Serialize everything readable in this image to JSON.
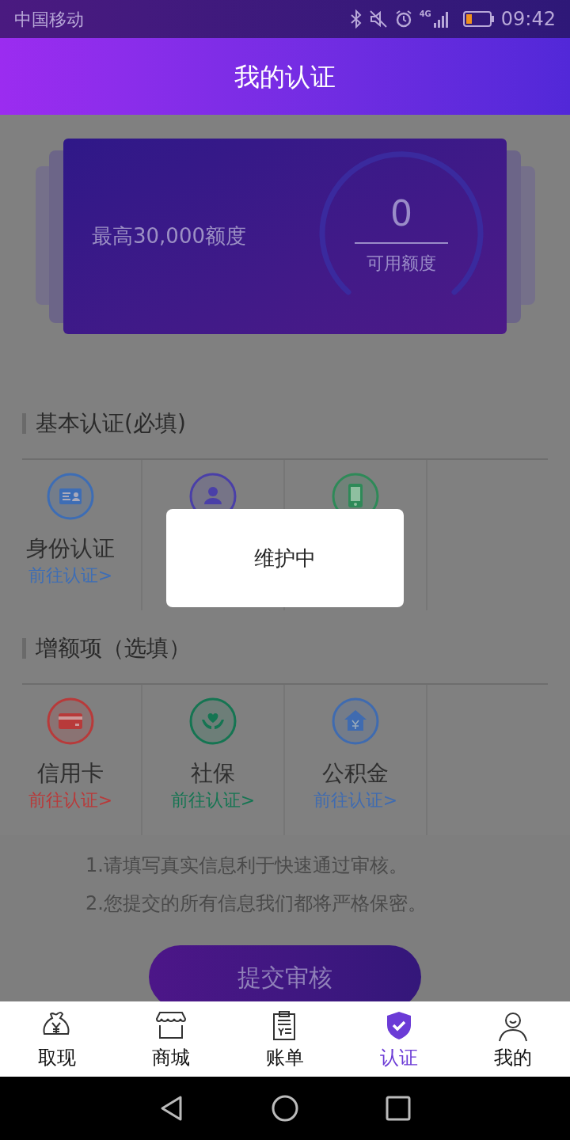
{
  "status_bar": {
    "carrier": "中国移动",
    "network": "4G",
    "time": "09:42"
  },
  "header": {
    "title": "我的认证"
  },
  "quota_card": {
    "headline": "最高30,000额度",
    "amount": "0",
    "amount_label": "可用额度"
  },
  "basic_section": {
    "title": "基本认证(必填)",
    "items": [
      {
        "kind": "id-card",
        "label": "身份认证",
        "link": "前往认证>",
        "color": "#3d6db5"
      },
      {
        "kind": "person",
        "color": "#4a3fa8"
      },
      {
        "kind": "phone",
        "color": "#2e8a58"
      }
    ]
  },
  "extra_section": {
    "title": "增额项（选填）",
    "items": [
      {
        "kind": "credit-card",
        "label": "信用卡",
        "link": "前往认证>",
        "color": "#b83a3a"
      },
      {
        "kind": "social-security",
        "label": "社保",
        "link": "前往认证>",
        "color": "#157552"
      },
      {
        "kind": "housing-fund",
        "label": "公积金",
        "link": "前往认证>",
        "color": "#3f6bb0"
      }
    ]
  },
  "notes": [
    "1.请填写真实信息利于快速通过审核。",
    "2.您提交的所有信息我们都将严格保密。"
  ],
  "submit_button": "提交审核",
  "dialog": {
    "message": "维护中"
  },
  "tab_bar": [
    {
      "kind": "money-bag",
      "label": "取现",
      "selected": false
    },
    {
      "kind": "shop",
      "label": "商城",
      "selected": false
    },
    {
      "kind": "bill",
      "label": "账单",
      "selected": false
    },
    {
      "kind": "shield",
      "label": "认证",
      "selected": true
    },
    {
      "kind": "person",
      "label": "我的",
      "selected": false
    }
  ]
}
